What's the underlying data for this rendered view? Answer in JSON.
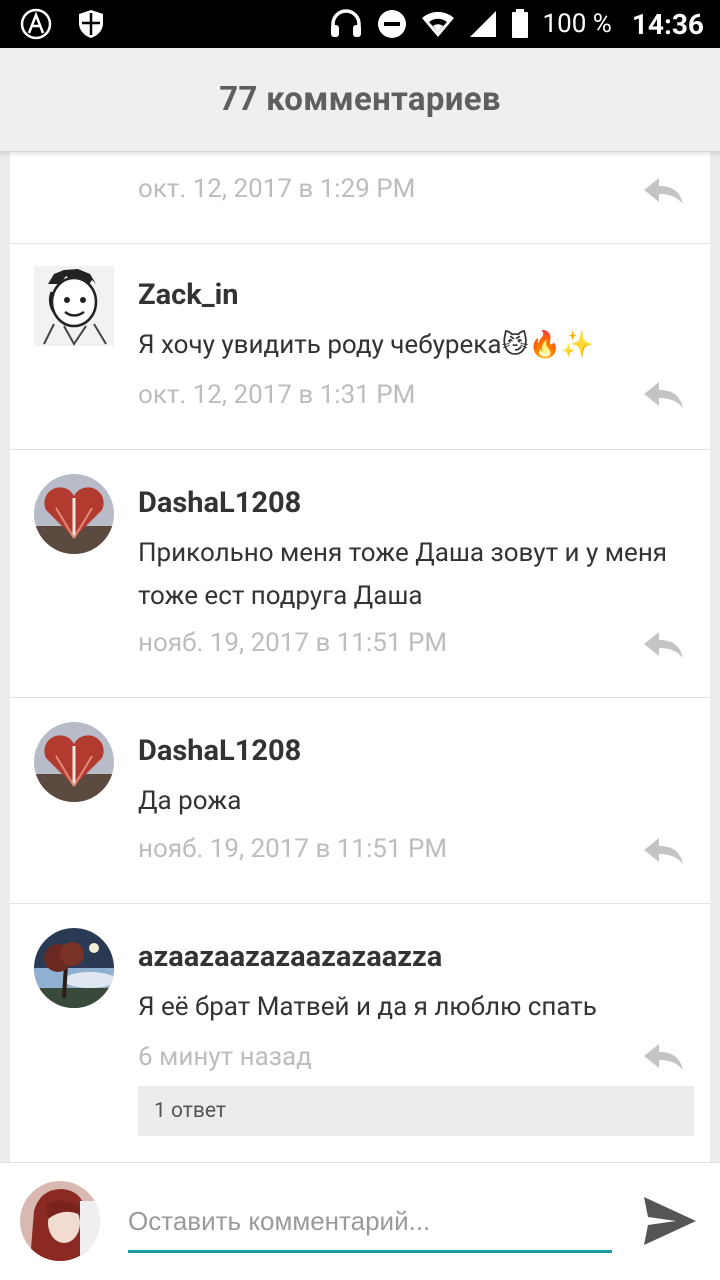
{
  "status_bar": {
    "battery": "100 %",
    "time": "14:36"
  },
  "header": {
    "title": "77 комментариев"
  },
  "comments": [
    {
      "author": "",
      "text": "",
      "date": "окт. 12, 2017 в 1:29 PM"
    },
    {
      "author": "Zack_in",
      "text": "Я хочу увидить роду чебурека😼🔥✨",
      "date": "окт. 12, 2017 в 1:31 PM",
      "avatar": "sketch-avatar"
    },
    {
      "author": "DashaL1208",
      "text": "Прикольно меня тоже Даша зовут и у меня тоже ест подруга Даша",
      "date": "нояб. 19, 2017 в 11:51 PM",
      "avatar": "heart-book-avatar"
    },
    {
      "author": "DashaL1208",
      "text": "Да рожа",
      "date": "нояб. 19, 2017 в 11:51 PM",
      "avatar": "heart-book-avatar"
    },
    {
      "author": "azaazaazazaazazaazza",
      "text": "Я её брат Матвей и да я люблю спать",
      "date": "6 минут назад",
      "avatar": "tree-sky-avatar",
      "replies": "1 ответ"
    }
  ],
  "input_bar": {
    "placeholder": "Оставить комментарий...",
    "accent_color": "#1a9aa0"
  },
  "icons": [
    "reply-icon",
    "send-icon",
    "headset-icon",
    "dnd-icon",
    "wifi-icon",
    "signal-icon",
    "battery-icon"
  ]
}
